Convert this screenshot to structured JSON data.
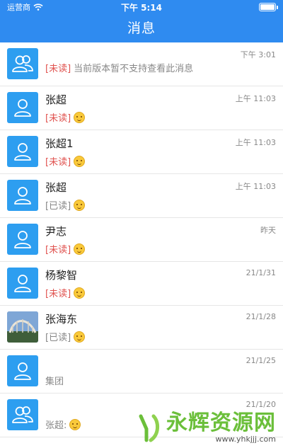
{
  "status_bar": {
    "carrier": "运营商",
    "time": "下午 5:14"
  },
  "header": {
    "title": "消息"
  },
  "messages": [
    {
      "name": "",
      "time": "下午 3:01",
      "tag": "[未读]",
      "tag_kind": "unread",
      "text": "当前版本暂不支持查看此消息",
      "emoji": false,
      "avatar": "group-avatar-icon"
    },
    {
      "name": "张超",
      "time": "上午 11:03",
      "tag": "[未读]",
      "tag_kind": "unread",
      "text": "",
      "emoji": true,
      "avatar": "person-avatar-icon"
    },
    {
      "name": "张超1",
      "time": "上午 11:03",
      "tag": "[未读]",
      "tag_kind": "unread",
      "text": "",
      "emoji": true,
      "avatar": "person-avatar-icon"
    },
    {
      "name": "张超",
      "time": "上午 11:03",
      "tag": "[已读]",
      "tag_kind": "read",
      "text": "",
      "emoji": true,
      "avatar": "person-avatar-icon"
    },
    {
      "name": "尹志",
      "time": "昨天",
      "tag": "[未读]",
      "tag_kind": "unread",
      "text": "",
      "emoji": true,
      "avatar": "person-avatar-icon"
    },
    {
      "name": "杨黎智",
      "time": "21/1/31",
      "tag": "[未读]",
      "tag_kind": "unread",
      "text": "",
      "emoji": true,
      "avatar": "person-avatar-icon"
    },
    {
      "name": "张海东",
      "time": "21/1/28",
      "tag": "[已读]",
      "tag_kind": "read",
      "text": "",
      "emoji": true,
      "avatar": "photo-avatar"
    },
    {
      "name": "",
      "time": "21/1/25",
      "tag": "",
      "tag_kind": "none",
      "text": "集团",
      "emoji": false,
      "avatar": "person-avatar-icon"
    },
    {
      "name": "",
      "time": "21/1/20",
      "tag": "",
      "tag_kind": "none",
      "text": "张超:",
      "emoji": true,
      "avatar": "group-avatar-icon"
    }
  ],
  "watermark": {
    "text": "永辉资源网",
    "url": "www.yhkjjj.com"
  },
  "colors": {
    "header": "#2f8bf0",
    "avatar": "#2d9ef0",
    "unread": "#e0524f"
  }
}
